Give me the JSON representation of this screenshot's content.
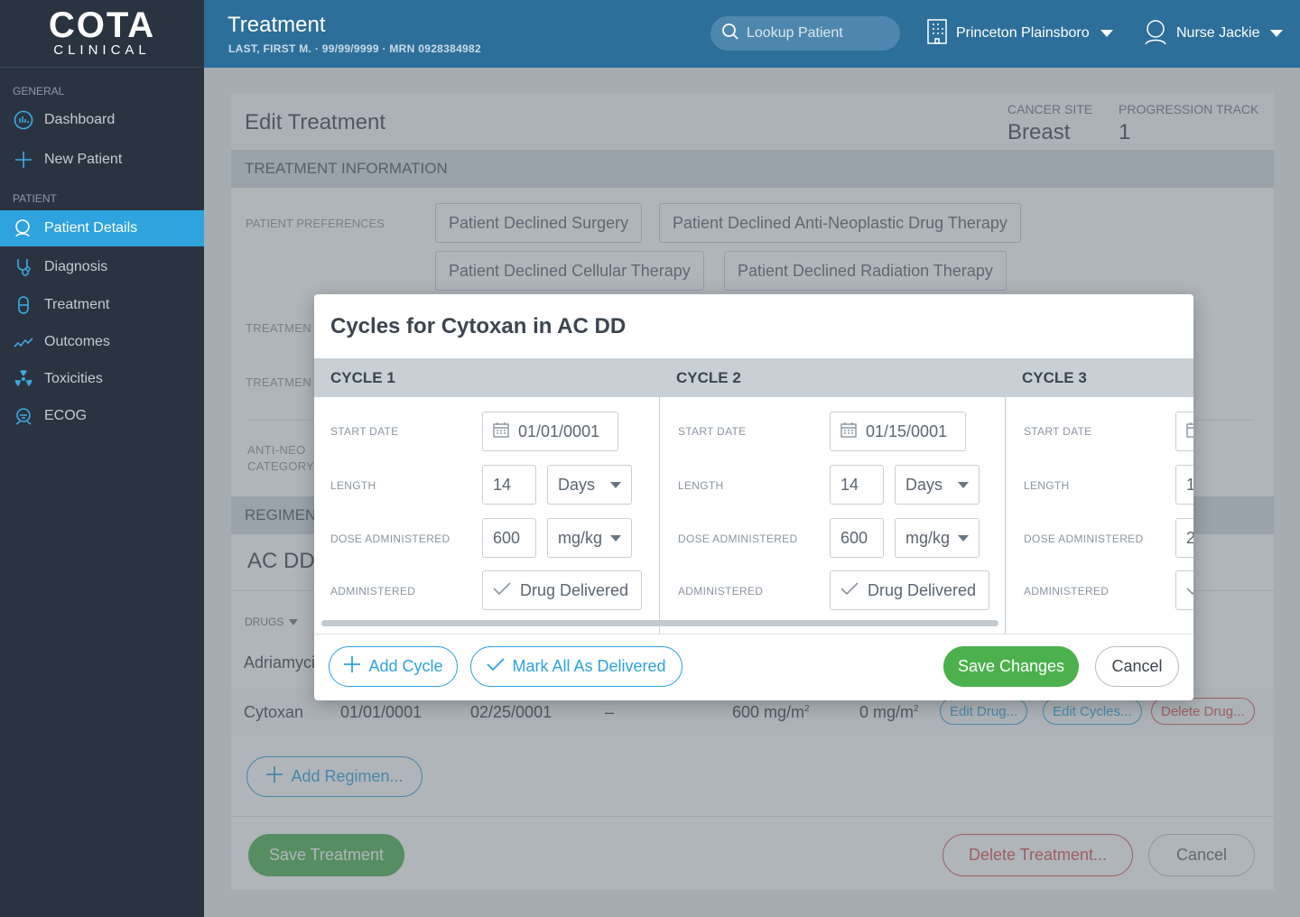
{
  "logo": {
    "main": "COTA",
    "sub": "CLINICAL"
  },
  "sidebar": {
    "sections": [
      {
        "title": "GENERAL",
        "items": [
          {
            "label": "Dashboard",
            "icon": "dashboard-icon"
          },
          {
            "label": "New Patient",
            "icon": "plus-icon"
          }
        ]
      },
      {
        "title": "PATIENT",
        "items": [
          {
            "label": "Patient Details",
            "icon": "patient-icon",
            "active": true
          },
          {
            "label": "Diagnosis",
            "icon": "stethoscope-icon"
          },
          {
            "label": "Treatment",
            "icon": "capsule-icon"
          },
          {
            "label": "Outcomes",
            "icon": "trend-icon"
          },
          {
            "label": "Toxicities",
            "icon": "radiation-icon"
          },
          {
            "label": "ECOG",
            "icon": "ecog-icon"
          }
        ]
      }
    ]
  },
  "header": {
    "title": "Treatment",
    "subtitle": "LAST, FIRST M. · 99/99/9999 · MRN 0928384982",
    "search_placeholder": "Lookup Patient",
    "facility": "Princeton Plainsboro",
    "user": "Nurse Jackie"
  },
  "page": {
    "title": "Edit Treatment",
    "cancer_site_label": "CANCER SITE",
    "cancer_site": "Breast",
    "progression_label": "PROGRESSION TRACK",
    "progression": "1",
    "section_info": "TREATMENT INFORMATION",
    "pref_label": "PATIENT PREFERENCES",
    "preferences": [
      "Patient Declined Surgery",
      "Patient Declined Anti-Neoplastic Drug Therapy",
      "Patient Declined Cellular Therapy",
      "Patient Declined Radiation Therapy"
    ],
    "treatment_label_1": "TREATMEN",
    "treatment_label_2": "TREATMEN",
    "anti_neo_label_1": "ANTI-NEO",
    "anti_neo_label_2": "CATEGORY",
    "section_regimen": "REGIMEN",
    "regimen_name": "AC DD",
    "drugs_header": "DRUGS",
    "drug_rows": [
      {
        "name": "Adriamyci"
      },
      {
        "name": "Cytoxan",
        "start": "01/01/0001",
        "end": "02/25/0001",
        "dash": "–",
        "dose": "600 mg/m",
        "dose_sup": "2",
        "dose2": "0 mg/m",
        "dose2_sup": "2"
      }
    ],
    "edit_drug": "Edit Drug...",
    "edit_cycles": "Edit Cycles...",
    "delete_drug": "Delete Drug...",
    "add_regimen": "Add Regimen...",
    "save_treatment": "Save Treatment",
    "delete_treatment": "Delete Treatment...",
    "cancel": "Cancel"
  },
  "modal": {
    "title": "Cycles for Cytoxan in AC DD",
    "labels": {
      "start_date": "START DATE",
      "length": "LENGTH",
      "dose": "DOSE ADMINISTERED",
      "administered": "ADMINISTERED"
    },
    "cycles": [
      {
        "name": "CYCLE 1",
        "start_date": "01/01/0001",
        "length": "14",
        "length_unit": "Days",
        "dose": "600",
        "dose_unit": "mg/kg",
        "administered": "Drug Delivered"
      },
      {
        "name": "CYCLE 2",
        "start_date": "01/15/0001",
        "length": "14",
        "length_unit": "Days",
        "dose": "600",
        "dose_unit": "mg/kg",
        "administered": "Drug Delivered"
      },
      {
        "name": "CYCLE 3",
        "start_date": "",
        "length": "1",
        "length_unit": "",
        "dose": "2",
        "dose_unit": "",
        "administered": ""
      }
    ],
    "add_cycle": "Add Cycle",
    "mark_all": "Mark All As Delivered",
    "save_changes": "Save Changes",
    "cancel": "Cancel"
  },
  "colors": {
    "accent": "#2ea3dd",
    "header": "#2c6f9a",
    "sidebar": "#2a3440",
    "success": "#4cb14c",
    "danger": "#d9534f"
  }
}
